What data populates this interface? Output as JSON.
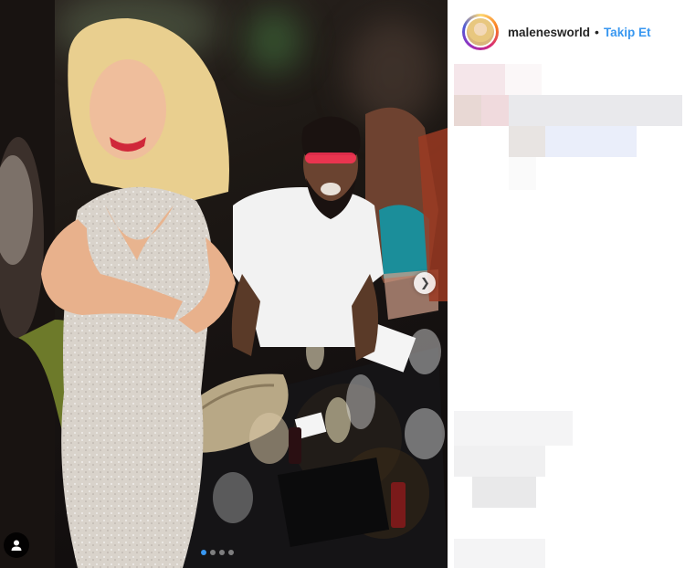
{
  "post": {
    "username": "malenesworld",
    "separator": "•",
    "follow_label": "Takip Et"
  },
  "carousel": {
    "slide_count": 4,
    "active_index": 0
  },
  "icons": {
    "next": "chevron-right-icon",
    "tag": "person-tag-icon"
  },
  "colors": {
    "accent": "#3897f0"
  }
}
